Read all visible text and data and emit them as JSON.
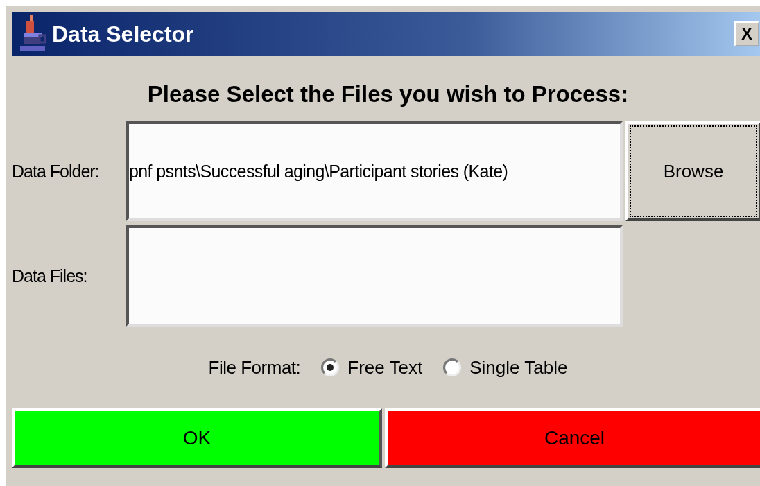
{
  "window": {
    "title": "Data Selector",
    "close_label": "X"
  },
  "heading": "Please Select the Files you wish to Process:",
  "data_folder": {
    "label": "Data Folder:",
    "value": "pnf psnts\\Successful aging\\Participant stories (Kate)"
  },
  "browse_button": {
    "label": "Browse",
    "focused": true
  },
  "data_files": {
    "label": "Data Files:"
  },
  "file_format": {
    "label": "File Format:",
    "options": [
      {
        "label": "Free Text",
        "selected": true
      },
      {
        "label": "Single Table",
        "selected": false
      }
    ]
  },
  "buttons": [
    {
      "label": "OK",
      "color": "#00ff00"
    },
    {
      "label": "Cancel",
      "color": "#ff0000"
    }
  ]
}
